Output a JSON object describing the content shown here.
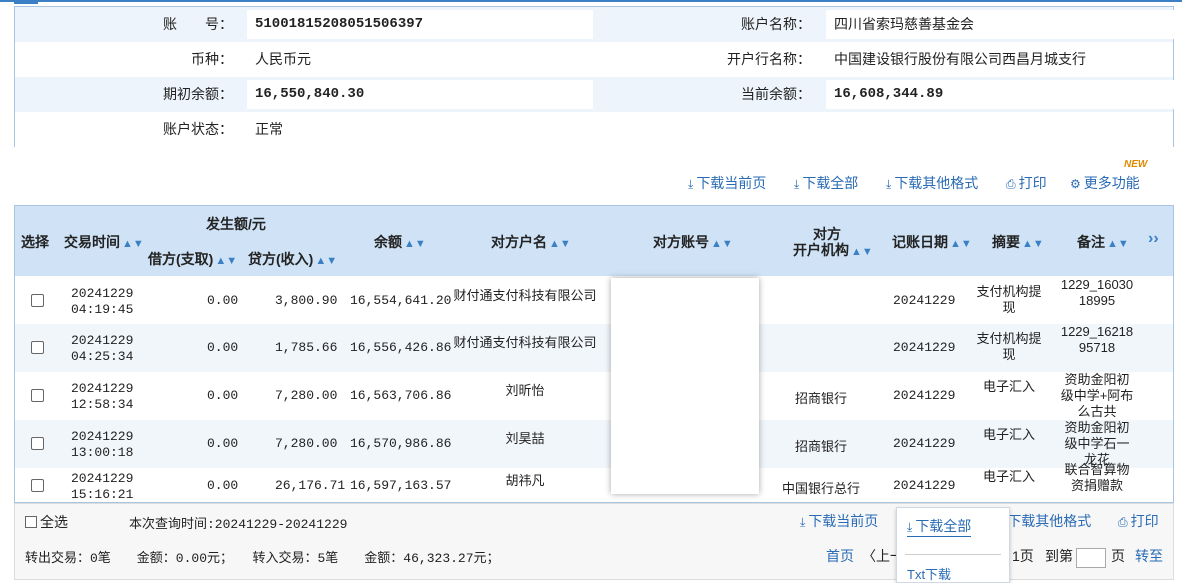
{
  "account": {
    "labels": {
      "account_no": "账　　号：",
      "account_name": "账户名称：",
      "currency": "币种：",
      "bank_name": "开户行名称：",
      "opening_balance": "期初余额：",
      "current_balance": "当前余额：",
      "status": "账户状态："
    },
    "account_no": "51001815208051506397",
    "account_name": "四川省索玛慈善基金会",
    "currency": "人民币元",
    "bank_name": "中国建设银行股份有限公司西昌月城支行",
    "opening_balance": "16,550,840.30",
    "current_balance": "16,608,344.89",
    "status": "正常"
  },
  "toolbar": {
    "new_badge": "NEW",
    "download_current": "下载当前页",
    "download_all": "下载全部",
    "download_other": "下载其他格式",
    "print": "打印",
    "more": "更多功能"
  },
  "table": {
    "headers": {
      "select": "选择",
      "time": "交易时间",
      "amount_group": "发生额/元",
      "debit": "借方(支取)",
      "credit": "贷方(收入)",
      "balance": "余额",
      "counterparty_name": "对方户名",
      "counterparty_account": "对方账号",
      "counterparty_bank_1": "对方",
      "counterparty_bank_2": "开户机构",
      "post_date": "记账日期",
      "summary": "摘要",
      "remark": "备注",
      "expand": "››"
    },
    "rows": [
      {
        "date": "20241229",
        "time": "04:19:45",
        "debit": "0.00",
        "credit": "3,800.90",
        "balance": "16,554,641.20",
        "name": "财付通支付科技有限公司",
        "bank": "",
        "post_date": "20241229",
        "summary": "支付机构提现",
        "remark": "1229_16030 18995"
      },
      {
        "date": "20241229",
        "time": "04:25:34",
        "debit": "0.00",
        "credit": "1,785.66",
        "balance": "16,556,426.86",
        "name": "财付通支付科技有限公司",
        "bank": "",
        "post_date": "20241229",
        "summary": "支付机构提现",
        "remark": "1229_16218 95718"
      },
      {
        "date": "20241229",
        "time": "12:58:34",
        "debit": "0.00",
        "credit": "7,280.00",
        "balance": "16,563,706.86",
        "name": "刘昕怡",
        "bank": "招商银行",
        "post_date": "20241229",
        "summary": "电子汇入",
        "remark": "资助金阳初级中学+阿布么古共"
      },
      {
        "date": "20241229",
        "time": "13:00:18",
        "debit": "0.00",
        "credit": "7,280.00",
        "balance": "16,570,986.86",
        "name": "刘昊喆",
        "bank": "招商银行",
        "post_date": "20241229",
        "summary": "电子汇入",
        "remark": "资助金阳初级中学石一龙花"
      },
      {
        "date": "20241229",
        "time": "15:16:21",
        "debit": "0.00",
        "credit": "26,176.71",
        "balance": "16,597,163.57",
        "name": "胡祎凡",
        "bank": "中国银行总行",
        "post_date": "20241229",
        "summary": "电子汇入",
        "remark": "联合智算物资捐赠款"
      }
    ]
  },
  "footer": {
    "select_all": "全选",
    "query_period": "本次查询时间:20241229-20241229",
    "download_current": "下载当前页",
    "download_all": "下载全部",
    "download_other": "下载其他格式",
    "print": "打印",
    "summary": "转出交易：0笔　　金额：0.00元；　　转入交易：5笔　　金额：46,323.27元；",
    "first_page": "首页",
    "prev_page": "〈上一",
    "page_suffix": "1页",
    "goto_prefix": "到第",
    "goto_suffix": "页",
    "goto_button": "转至"
  },
  "dropdown": {
    "txt_download": "Txt下载"
  },
  "colors": {
    "accent": "#3b7fc4",
    "link": "#2a6bb5",
    "header_bg": "#cfe2f6",
    "info_row_bg": "#eef4fb"
  }
}
